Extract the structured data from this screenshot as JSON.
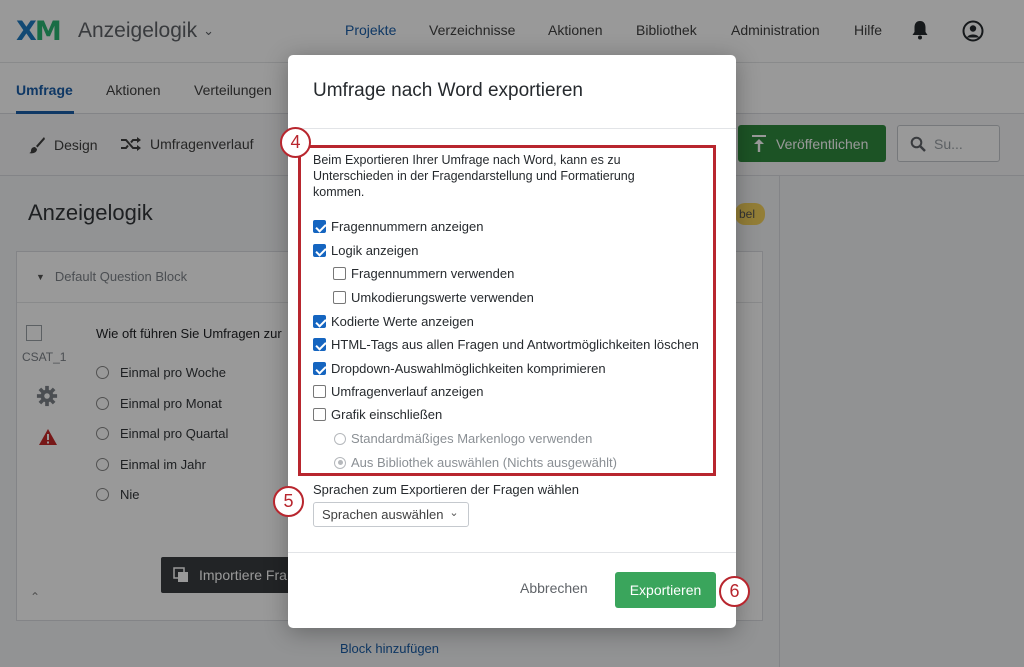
{
  "app": {
    "logo_main": "X",
    "logo_accent": "M",
    "project_title": "Anzeigelogik",
    "nav": [
      "Projekte",
      "Verzeichnisse",
      "Aktionen",
      "Bibliothek",
      "Administration",
      "Hilfe"
    ],
    "active_nav": "Projekte"
  },
  "subnav": {
    "tabs": [
      "Umfrage",
      "Aktionen",
      "Verteilungen"
    ],
    "active": "Umfrage"
  },
  "toolbar": {
    "design": "Design",
    "flow": "Umfragenverlauf",
    "publish": "Veröffentlichen",
    "search_placeholder": "Su..."
  },
  "page": {
    "heading": "Anzeigelogik",
    "label_fragment": "bel"
  },
  "block": {
    "title": "Default Question Block",
    "question_id": "CSAT_1",
    "question_text": "Wie oft führen Sie Umfragen zur",
    "choices": [
      "Einmal pro Woche",
      "Einmal pro Monat",
      "Einmal pro Quartal",
      "Einmal im Jahr",
      "Nie"
    ],
    "import_button": "Importiere Fra",
    "add_block": "Block hinzufügen"
  },
  "modal": {
    "title": "Umfrage nach Word exportieren",
    "intro": "Beim Exportieren Ihrer Umfrage nach Word, kann es zu Unterschieden in der Fragendarstellung und Formatierung kommen.",
    "options": [
      {
        "label": "Fragennummern anzeigen",
        "checked": true
      },
      {
        "label": "Logik anzeigen",
        "checked": true
      },
      {
        "label": "Fragennummern verwenden",
        "checked": false
      },
      {
        "label": "Umkodierungswerte verwenden",
        "checked": false
      },
      {
        "label": "Kodierte Werte anzeigen",
        "checked": true
      },
      {
        "label": "HTML-Tags aus allen Fragen und Antwortmöglichkeiten löschen",
        "checked": true
      },
      {
        "label": "Dropdown-Auswahlmöglichkeiten komprimieren",
        "checked": true
      },
      {
        "label": "Umfragenverlauf anzeigen",
        "checked": false
      },
      {
        "label": "Grafik einschließen",
        "checked": false
      }
    ],
    "graphic_options": [
      {
        "label": "Standardmäßiges Markenlogo verwenden",
        "selected": false
      },
      {
        "label": "Aus Bibliothek auswählen (Nichts ausgewählt)",
        "selected": true
      }
    ],
    "language_label": "Sprachen zum Exportieren der Fragen wählen",
    "language_select": "Sprachen auswählen",
    "cancel": "Abbrechen",
    "export": "Exportieren"
  },
  "callouts": [
    "4",
    "5",
    "6"
  ],
  "colors": {
    "brand_blue": "#1a5ea8",
    "export_green": "#3aa55c",
    "publish_green": "#2f8a3f",
    "callout_red": "#b8262e",
    "checkbox_blue": "#1565c0"
  }
}
